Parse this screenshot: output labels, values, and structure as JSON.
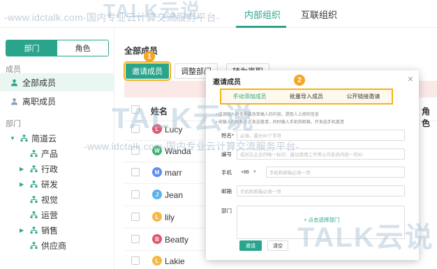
{
  "top_tabs": [
    {
      "label": "内部组织",
      "active": true
    },
    {
      "label": "互联组织",
      "active": false
    }
  ],
  "sidebar": {
    "segments": [
      {
        "label": "部门",
        "active": true
      },
      {
        "label": "角色",
        "active": false
      }
    ],
    "members_section": "成员",
    "members": [
      {
        "label": "全部成员",
        "selected": true
      },
      {
        "label": "离职成员",
        "selected": false
      }
    ],
    "dept_section": "部门",
    "tree": [
      {
        "label": "简道云",
        "expanded": true,
        "level": 0
      },
      {
        "label": "产品",
        "expandable": false,
        "level": 1
      },
      {
        "label": "行政",
        "expandable": true,
        "level": 1
      },
      {
        "label": "研发",
        "expandable": true,
        "level": 1
      },
      {
        "label": "视觉",
        "expandable": false,
        "level": 1
      },
      {
        "label": "运营",
        "expandable": false,
        "level": 1
      },
      {
        "label": "销售",
        "expandable": true,
        "level": 1
      },
      {
        "label": "供应商",
        "expandable": false,
        "level": 1
      }
    ]
  },
  "main": {
    "title": "全部成员",
    "invite_button": "邀请成员",
    "adjust_button": "调整部门",
    "partial_button": "转为离职",
    "step1": "1",
    "step2": "2",
    "columns": {
      "name": "姓名",
      "role": "角色"
    },
    "rows": [
      {
        "initial": "L",
        "name": "Lucy",
        "color": "#e0576a"
      },
      {
        "initial": "W",
        "name": "Wanda",
        "color": "#3cb371"
      },
      {
        "initial": "M",
        "name": "marr",
        "color": "#5b8def"
      },
      {
        "initial": "J",
        "name": "Jean",
        "color": "#5ab4e6"
      },
      {
        "initial": "L",
        "name": "lily",
        "color": "#f5b942"
      },
      {
        "initial": "B",
        "name": "Beatty",
        "color": "#e0576a"
      },
      {
        "initial": "L",
        "name": "Lakie",
        "color": "#f5b942"
      }
    ]
  },
  "modal": {
    "title": "邀请成员",
    "tabs": [
      {
        "label": "手动添加成员",
        "active": true
      },
      {
        "label": "批量导入成员",
        "active": false
      },
      {
        "label": "公开链接邀请",
        "active": false
      }
    ],
    "notes": [
      "• 成员加入时无需要改草稿人的内容，提取人上修的信息",
      "• 按输入的联系方式发送邀请，同时输入手机和邮箱，开发选手机邀请"
    ],
    "fields": {
      "name_label": "姓名*",
      "name_placeholder": "必填，最长80个字符",
      "id_label": "编号",
      "id_placeholder": "成员在企业内唯一标识，建议使用工号等公司系统内统一的ID",
      "phone_label": "手机",
      "phone_code": "+86",
      "phone_placeholder": "手机和邮箱必填一项",
      "email_label": "邮箱",
      "email_placeholder": "手机和邮箱必填一项",
      "dept_label": "部门",
      "dept_pick": "+ 点击选择部门"
    },
    "invite_button": "邀请",
    "clear_button": "清空"
  },
  "watermark": {
    "url_text": "-www.idctalk.com-国内专业云计算交流服务平台-",
    "logo_text": "TALK云说"
  },
  "colors": {
    "accent": "#2aa58c",
    "highlight": "#f5b21a",
    "badge": "#f5a623"
  }
}
